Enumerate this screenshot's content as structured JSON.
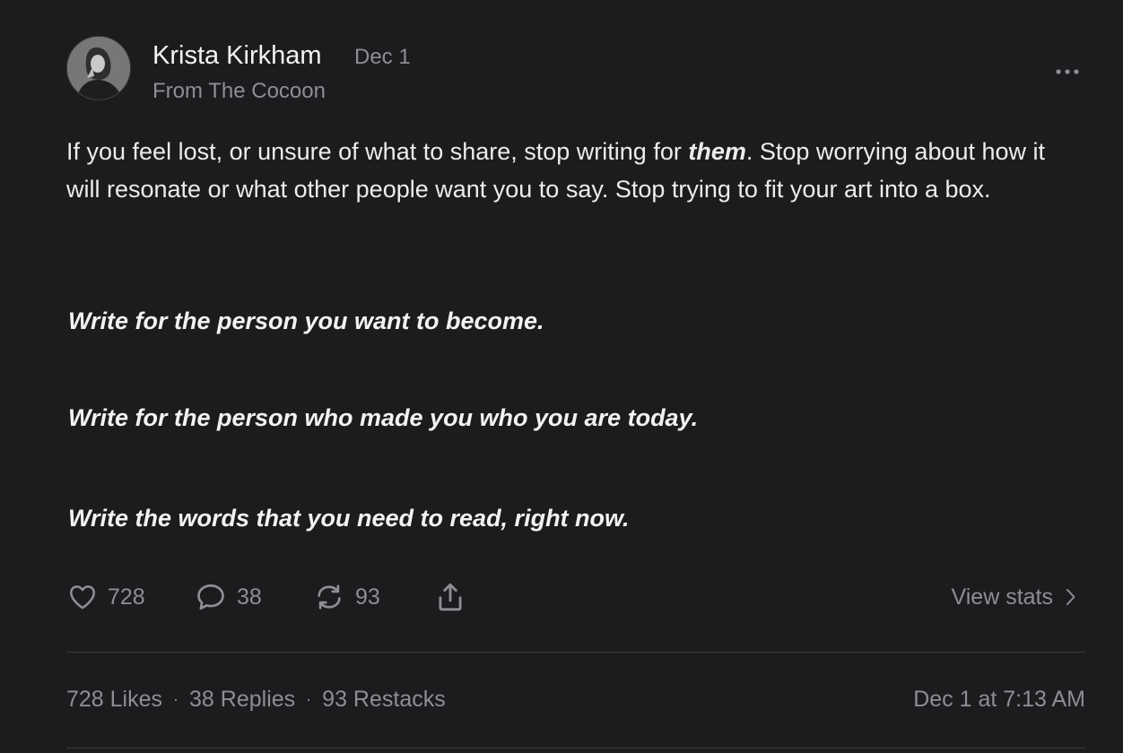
{
  "post": {
    "author": "Krista Kirkham",
    "date": "Dec 1",
    "publication": "From The Cocoon",
    "body_before": "If you feel lost, or unsure of what to share, stop writing for ",
    "body_emphasis": "them",
    "body_after": ". Stop worrying about how it will resonate or what other people want you to say. Stop trying to fit your art into a box.",
    "quotes": [
      "Write for the person you want to become.",
      "Write for the person who made you who you are today.",
      "Write the words that you need to read, right now."
    ]
  },
  "actions": {
    "likes": "728",
    "replies": "38",
    "restacks": "93",
    "view_stats": "View stats"
  },
  "footer": {
    "likes": "728 Likes",
    "replies": "38 Replies",
    "restacks": "93 Restacks",
    "separator": "·",
    "timestamp": "Dec 1 at 7:13 AM"
  },
  "icons": {
    "more": "more-horizontal-icon",
    "like": "heart-icon",
    "reply": "comment-icon",
    "restack": "restack-icon",
    "share": "share-icon",
    "chevron": "chevron-right-icon"
  }
}
